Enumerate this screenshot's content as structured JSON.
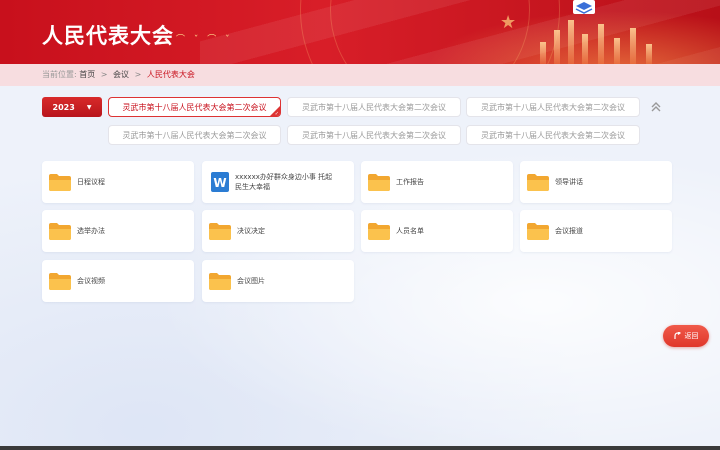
{
  "header": {
    "title": "人民代表大会"
  },
  "breadcrumb": {
    "prefix": "当前位置:",
    "items": [
      "首页",
      "会议"
    ],
    "separator": ">",
    "current": "人民代表大会"
  },
  "year_select": {
    "value": "2023"
  },
  "meeting_tags": [
    "灵武市第十八届人民代表大会第二次会议",
    "灵武市第十八届人民代表大会第二次会议",
    "灵武市第十八届人民代表大会第二次会议",
    "灵武市第十八届人民代表大会第二次会议",
    "灵武市第十八届人民代表大会第二次会议",
    "灵武市第十八届人民代表大会第二次会议"
  ],
  "cards": [
    {
      "label": "日程议程",
      "icon": "folder-icon"
    },
    {
      "label": "xxxxxx办好群众身边小事 托起民生大幸福",
      "icon": "word-document-icon"
    },
    {
      "label": "工作报告",
      "icon": "folder-icon"
    },
    {
      "label": "领导讲话",
      "icon": "folder-icon"
    },
    {
      "label": "选举办法",
      "icon": "folder-icon"
    },
    {
      "label": "决议决定",
      "icon": "folder-icon"
    },
    {
      "label": "人员名单",
      "icon": "folder-icon"
    },
    {
      "label": "会议报道",
      "icon": "folder-icon"
    },
    {
      "label": "会议视频",
      "icon": "folder-icon"
    },
    {
      "label": "会议图片",
      "icon": "folder-icon"
    }
  ],
  "back_button": {
    "label": "返回"
  },
  "colors": {
    "primary_red": "#c8101c",
    "folder_yellow": "#f7b53b",
    "word_blue": "#2b7cd3"
  }
}
